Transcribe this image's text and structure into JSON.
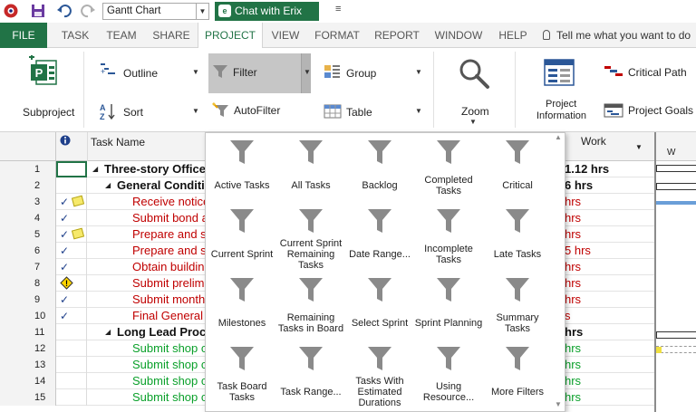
{
  "qat": {
    "view_select_value": "Gantt Chart",
    "chat_label": "Chat with Erix",
    "more_glyph": "≡"
  },
  "tabs": [
    "FILE",
    "TASK",
    "TEAM",
    "SHARE",
    "PROJECT",
    "VIEW",
    "FORMAT",
    "REPORT",
    "WINDOW",
    "HELP"
  ],
  "active_tab": "PROJECT",
  "tell_me": "Tell me what you want to do",
  "ribbon": {
    "subproject": "Subproject",
    "outline": "Outline",
    "sort": "Sort",
    "filter": "Filter",
    "autofilter": "AutoFilter",
    "group": "Group",
    "table": "Table",
    "zoom": "Zoom",
    "project_information": [
      "Project",
      "Information"
    ],
    "critical_path": "Critical Path",
    "project_goals": "Project Goals"
  },
  "grid": {
    "header_task_name": "Task Name",
    "header_work": "Work",
    "gantt_header": "W",
    "rows": [
      {
        "num": "1",
        "name": "Three-story Office",
        "work": "1.12 hrs",
        "style": "bold",
        "level": 0,
        "collapse": true,
        "indicators": []
      },
      {
        "num": "2",
        "name": "General Conditi",
        "work": "6 hrs",
        "style": "bold",
        "level": 1,
        "collapse": true,
        "indicators": []
      },
      {
        "num": "3",
        "name": "Receive notice",
        "work": "hrs",
        "style": "red",
        "level": 2,
        "indicators": [
          "check",
          "note"
        ]
      },
      {
        "num": "4",
        "name": "Submit bond a",
        "work": "hrs",
        "style": "red",
        "level": 2,
        "indicators": [
          "check"
        ]
      },
      {
        "num": "5",
        "name": "Prepare and s",
        "work": "hrs",
        "style": "red",
        "level": 2,
        "indicators": [
          "check",
          "note"
        ]
      },
      {
        "num": "6",
        "name": "Prepare and s",
        "work": "5 hrs",
        "style": "red",
        "level": 2,
        "indicators": [
          "check"
        ]
      },
      {
        "num": "7",
        "name": "Obtain building",
        "work": "hrs",
        "style": "red",
        "level": 2,
        "indicators": [
          "check"
        ]
      },
      {
        "num": "8",
        "name": "Submit prelimi",
        "work": "hrs",
        "style": "red",
        "level": 2,
        "indicators": [
          "warning"
        ]
      },
      {
        "num": "9",
        "name": "Submit month",
        "work": "hrs",
        "style": "red",
        "level": 2,
        "indicators": [
          "check"
        ]
      },
      {
        "num": "10",
        "name": "Final General C",
        "work": "s",
        "style": "red",
        "level": 2,
        "indicators": [
          "check"
        ]
      },
      {
        "num": "11",
        "name": "Long Lead Procu",
        "work": "hrs",
        "style": "bold",
        "level": 1,
        "collapse": true,
        "indicators": []
      },
      {
        "num": "12",
        "name": "Submit shop c",
        "work": "hrs",
        "style": "green",
        "level": 2,
        "indicators": []
      },
      {
        "num": "13",
        "name": "Submit shop c",
        "work": "hrs",
        "style": "green",
        "level": 2,
        "indicators": []
      },
      {
        "num": "14",
        "name": "Submit shop c",
        "work": "hrs",
        "style": "green",
        "level": 2,
        "indicators": []
      },
      {
        "num": "15",
        "name": "Submit shop c",
        "work": "hrs",
        "style": "green",
        "level": 2,
        "indicators": []
      }
    ]
  },
  "filter_menu": {
    "items": [
      [
        "Active Tasks"
      ],
      [
        "All Tasks"
      ],
      [
        "Backlog"
      ],
      [
        "Completed",
        "Tasks"
      ],
      [
        "Critical"
      ],
      [
        "Current Sprint"
      ],
      [
        "Current Sprint",
        "Remaining",
        "Tasks"
      ],
      [
        "Date Range..."
      ],
      [
        "Incomplete",
        "Tasks"
      ],
      [
        "Late Tasks"
      ],
      [
        "Milestones"
      ],
      [
        "Remaining",
        "Tasks in Board"
      ],
      [
        "Select Sprint"
      ],
      [
        "Sprint Planning"
      ],
      [
        "Summary",
        "Tasks"
      ],
      [
        "Task Board",
        "Tasks"
      ],
      [
        "Task Range..."
      ],
      [
        "Tasks With",
        "Estimated",
        "Durations"
      ],
      [
        "Using",
        "Resource..."
      ],
      [
        "More Filters"
      ]
    ]
  },
  "colors": {
    "brand_green": "#217346",
    "red_task": "#c00000",
    "green_task": "#0aa02a",
    "funnel": "#8a8a8a"
  }
}
